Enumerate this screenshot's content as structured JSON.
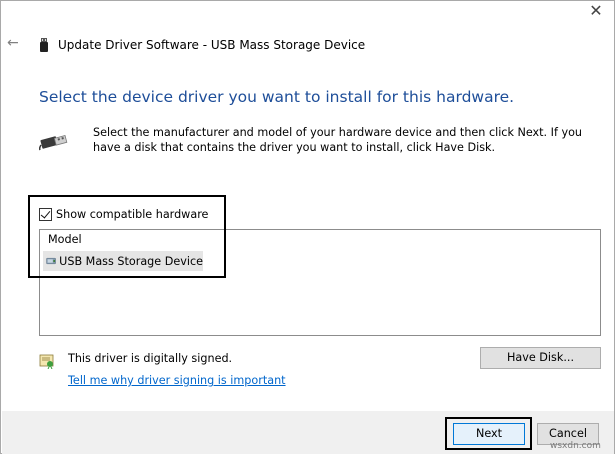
{
  "window": {
    "title": "Update Driver Software - USB Mass Storage Device",
    "close_glyph": "✕",
    "back_glyph": "←"
  },
  "main": {
    "heading": "Select the device driver you want to install for this hardware.",
    "description": "Select the manufacturer and model of your hardware device and then click Next. If you have a disk that contains the driver you want to install, click Have Disk.",
    "show_compatible": {
      "label": "Show compatible hardware",
      "checked": true
    },
    "model_list": {
      "header": "Model",
      "items": [
        {
          "label": "USB Mass Storage Device",
          "selected": true
        }
      ]
    },
    "signed_text": "This driver is digitally signed.",
    "signing_link": "Tell me why driver signing is important",
    "have_disk_label": "Have Disk..."
  },
  "footer": {
    "next_label": "Next",
    "cancel_label": "Cancel"
  },
  "watermark": "wsxdn.com",
  "colors": {
    "heading": "#1e4e99",
    "link": "#0066cc",
    "footer_bg": "#f0f0f0",
    "selected_row": "#e5e5e5",
    "default_button_border": "#0078d7"
  }
}
